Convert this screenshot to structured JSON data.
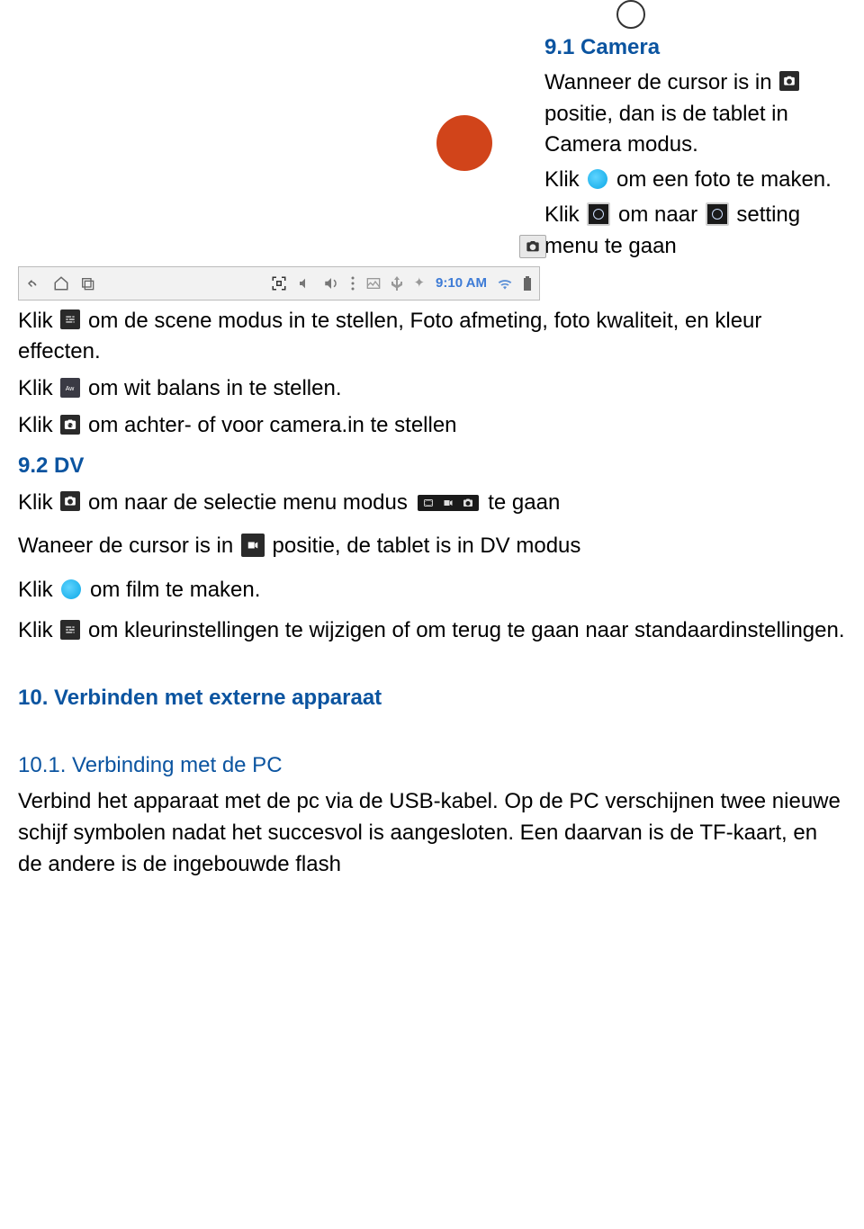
{
  "camera": {
    "title": "9.1 Camera",
    "intro_a": "Wanneer de cursor is in",
    "intro_b": "positie, dan is de tablet in Camera modus.",
    "takephoto_a": "Klik",
    "takephoto_b": "om een foto te maken.",
    "settings_a": "Klik",
    "settings_b": "om naar",
    "settings_c": "setting menu te gaan"
  },
  "body": {
    "scene_a": "Klik",
    "scene_b": "om de scene modus in te stellen, Foto afmeting, foto kwaliteit, en kleur effecten.",
    "wb_a": "Klik",
    "wb_b": "om wit balans in te stellen.",
    "camsel_a": "Klik",
    "camsel_b": "om achter- of voor camera.in te stellen"
  },
  "dv": {
    "title": "9.2 DV",
    "menu_a": "Klik",
    "menu_b": "om naar de selectie menu modus",
    "menu_c": "te gaan",
    "cursor_a": "Waneer de cursor is in",
    "cursor_b": "positie, de tablet is in DV modus",
    "film_a": "Klik",
    "film_b": "om film te maken.",
    "color_a": "Klik",
    "color_b": "om kleurinstellingen te wijzigen of om terug te gaan naar standaardinstellingen."
  },
  "connect": {
    "title": "10. Verbinden met externe apparaat",
    "pc_title": "10.1. Verbinding met de PC",
    "pc_body": "Verbind het apparaat met de pc via de USB-kabel. Op de PC verschijnen twee nieuwe schijf symbolen nadat  het succesvol is aangesloten. Een daarvan is de TF-kaart, en de andere is de ingebouwde flash"
  },
  "statusbar": {
    "time": "9:10 AM"
  }
}
